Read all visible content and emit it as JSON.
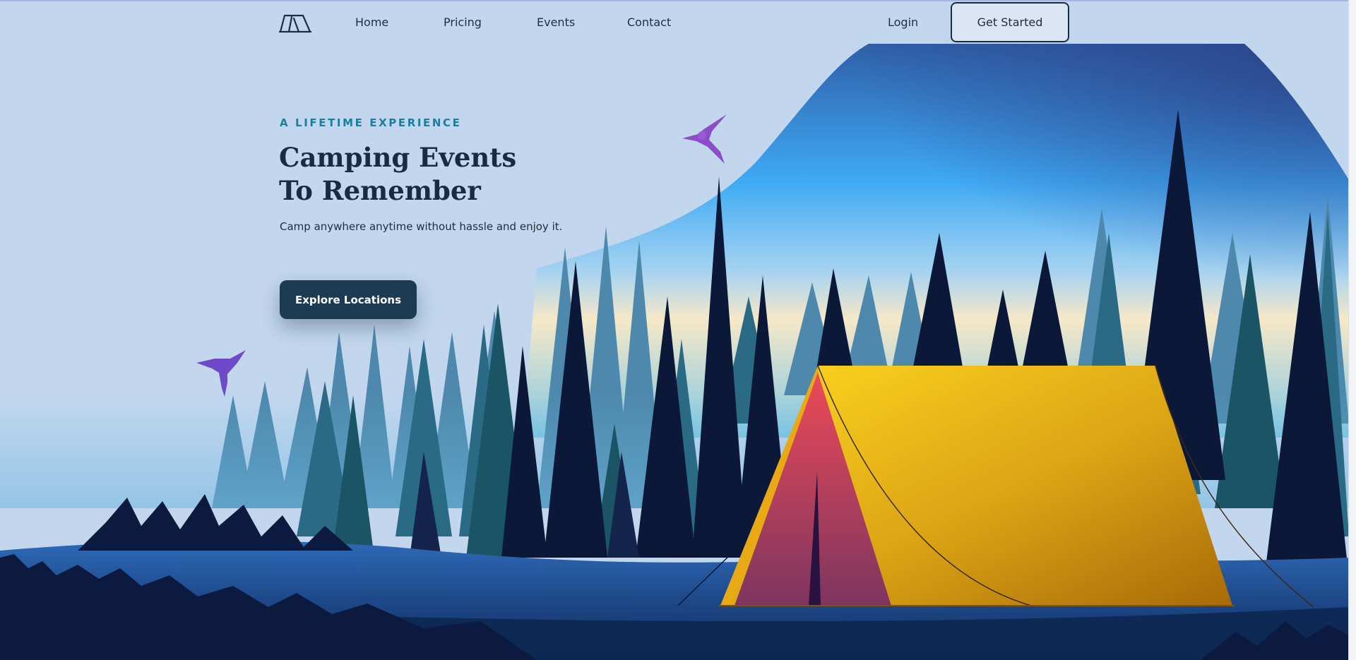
{
  "nav": {
    "logo_icon": "tent-logo-icon",
    "links": [
      {
        "label": "Home"
      },
      {
        "label": "Pricing"
      },
      {
        "label": "Events"
      },
      {
        "label": "Contact"
      }
    ],
    "login_label": "Login",
    "cta_label": "Get Started"
  },
  "hero": {
    "eyebrow": "A LIFETIME EXPERIENCE",
    "title_line1": "Camping Events",
    "title_line2": "To Remember",
    "subtitle": "Camp anywhere anytime without hassle and enjoy it.",
    "cta_label": "Explore Locations"
  },
  "illustration": {
    "icons": [
      "hummingbird-icon",
      "tent-icon",
      "pine-tree-icon"
    ],
    "colors": {
      "page_bg": "#c2d7ee",
      "sky_top": "#2f5fa8",
      "sky_mid": "#3faaf5",
      "sky_glow": "#f6e8c8",
      "tent_yellow": "#f5c118",
      "tent_orange": "#b8780c",
      "tent_door": "#e64a5a",
      "tree_dark": "#0b1838",
      "tree_teal": "#1c5a6a",
      "hummingbird": "#8a4cc8",
      "ground": "#14305c"
    }
  }
}
